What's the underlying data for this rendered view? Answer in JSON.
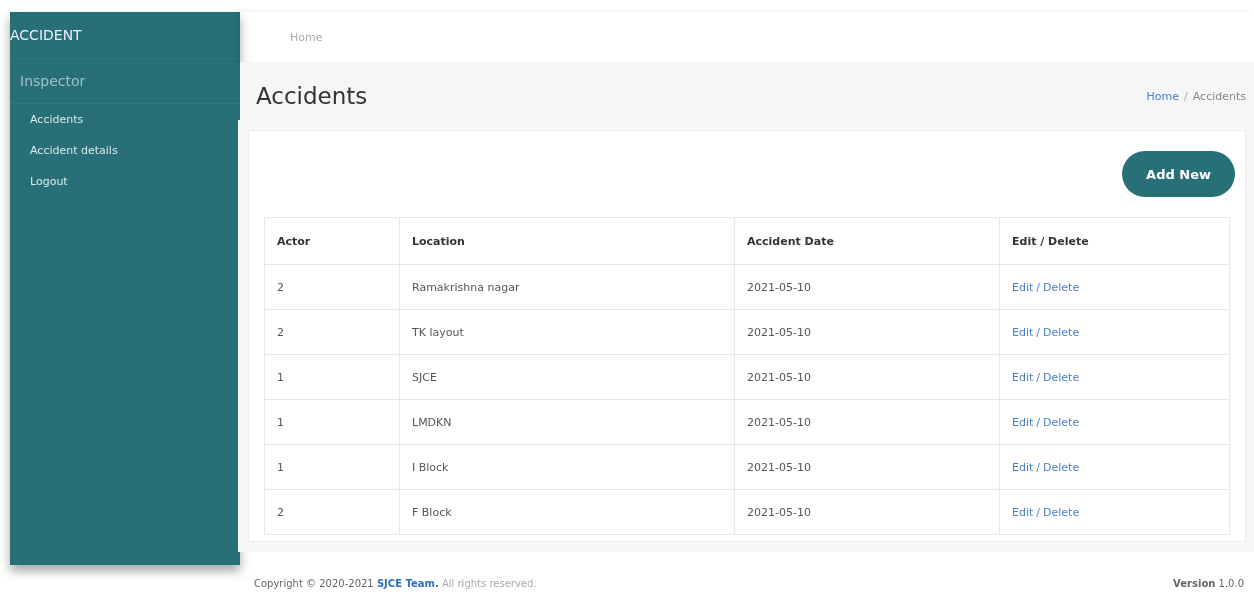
{
  "sidebar": {
    "brand": "ACCIDENT",
    "user": "Inspector",
    "items": [
      {
        "label": "Accidents",
        "selected": false
      },
      {
        "label": "Accident details",
        "selected": false
      },
      {
        "label": "Logout",
        "selected": false
      }
    ]
  },
  "navbar": {
    "links": [
      "Home"
    ]
  },
  "header": {
    "title": "Accidents",
    "breadcrumb": [
      {
        "label": "Home",
        "kind": "link"
      },
      {
        "label": "Accidents",
        "kind": "current"
      }
    ],
    "separator": "/"
  },
  "add_button": "Add New",
  "table": {
    "columns": [
      "Actor",
      "Location",
      "Accident Date",
      "Edit / Delete"
    ],
    "rows": [
      {
        "actor": "2",
        "location": "Ramakrishna nagar",
        "date": "2021-05-10",
        "edit": "Edit",
        "separator": "/",
        "delete": "Delete"
      },
      {
        "actor": "2",
        "location": "TK layout",
        "date": "2021-05-10",
        "edit": "Edit",
        "separator": "/",
        "delete": "Delete"
      },
      {
        "actor": "1",
        "location": "SJCE",
        "date": "2021-05-10",
        "edit": "Edit",
        "separator": "/",
        "delete": "Delete"
      },
      {
        "actor": "1",
        "location": "LMDKN",
        "date": "2021-05-10",
        "edit": "Edit",
        "separator": "/",
        "delete": "Delete"
      },
      {
        "actor": "1",
        "location": "I Block",
        "date": "2021-05-10",
        "edit": "Edit",
        "separator": "/",
        "delete": "Delete"
      },
      {
        "actor": "2",
        "location": "F Block",
        "date": "2021-05-10",
        "edit": "Edit",
        "separator": "/",
        "delete": "Delete"
      }
    ]
  },
  "footer": {
    "copyright": "Copyright © 2020-2021",
    "team": "SJCE Team.",
    "rights": "All rights reserved.",
    "version_label": "Version",
    "version": "1.0.0"
  }
}
